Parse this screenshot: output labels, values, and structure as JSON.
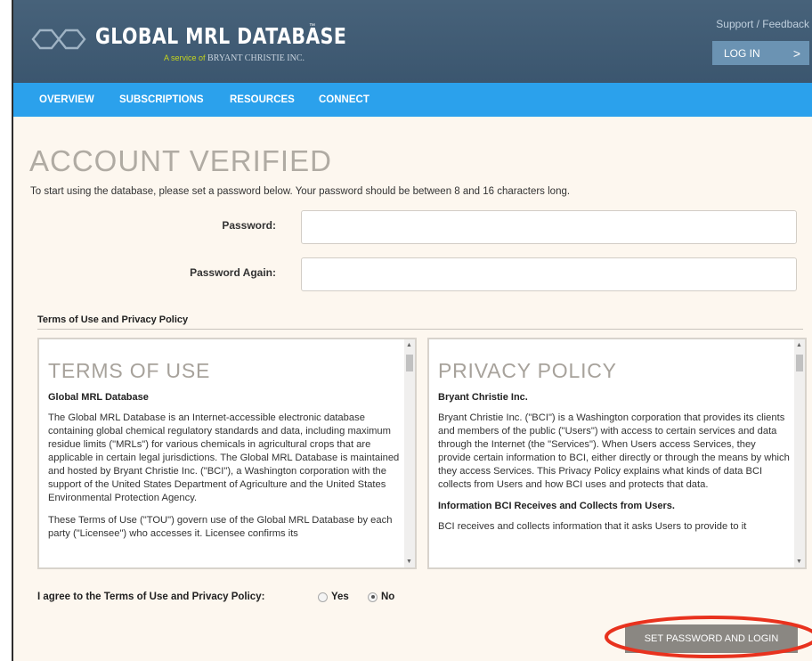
{
  "header": {
    "brand_name": "GLOBAL MRL DATABASE",
    "brand_tm": "™",
    "brand_sub_prefix": "A service of",
    "brand_sub_company": "BRYANT CHRISTIE INC.",
    "support_link": "Support / Feedback",
    "login_label": "LOG IN",
    "login_chevron": ">"
  },
  "nav": {
    "items": [
      "OVERVIEW",
      "SUBSCRIPTIONS",
      "RESOURCES",
      "CONNECT"
    ]
  },
  "main": {
    "title": "ACCOUNT VERIFIED",
    "intro": "To start using the database, please set a password below. Your password should be between 8 and 16 characters long.",
    "password_label": "Password:",
    "password_value": "",
    "password_again_label": "Password Again:",
    "password_again_value": ""
  },
  "terms": {
    "heading": "Terms of Use and Privacy Policy",
    "tou": {
      "title": "TERMS OF USE",
      "subtitle": "Global MRL Database",
      "para1": "The Global MRL Database is an Internet-accessible electronic database containing global chemical regulatory standards and data, including maximum residue limits (\"MRLs\") for various chemicals in agricultural crops that are applicable in certain legal jurisdictions. The Global MRL Database is maintained and hosted by Bryant Christie Inc. (\"BCI\"), a Washington corporation with the support of the United States Department of Agriculture and the United States Environmental Protection Agency.",
      "para2": "These Terms of Use (\"TOU\") govern use of the Global MRL Database by each party (\"Licensee\") who accesses it. Licensee confirms its"
    },
    "privacy": {
      "title": "PRIVACY POLICY",
      "subtitle": "Bryant Christie Inc.",
      "para1": "Bryant Christie Inc. (\"BCI\") is a Washington corporation that provides its clients and members of the public (\"Users\") with access to certain services and data through the Internet (the \"Services\"). When Users access Services, they provide certain information to BCI, either directly or through the means by which they access Services. This Privacy Policy explains what kinds of data BCI collects from Users and how BCI uses and protects that data.",
      "subtitle2": "Information BCI Receives and Collects from Users.",
      "para2": "BCI receives and collects information that it asks Users to provide to it"
    },
    "scroll_up": "▲",
    "scroll_down": "▼"
  },
  "agree": {
    "label": "I agree to the Terms of Use and Privacy Policy:",
    "yes_label": "Yes",
    "no_label": "No",
    "selected": "No"
  },
  "actions": {
    "submit_label": "SET PASSWORD AND LOGIN"
  },
  "colors": {
    "header_bg": "#3b566f",
    "nav_bg": "#2ba1ec",
    "page_bg": "#fdf7ef",
    "login_btn": "#6b93b3",
    "submit_btn": "#8a8782",
    "annotation_ellipse": "#e8321e"
  }
}
